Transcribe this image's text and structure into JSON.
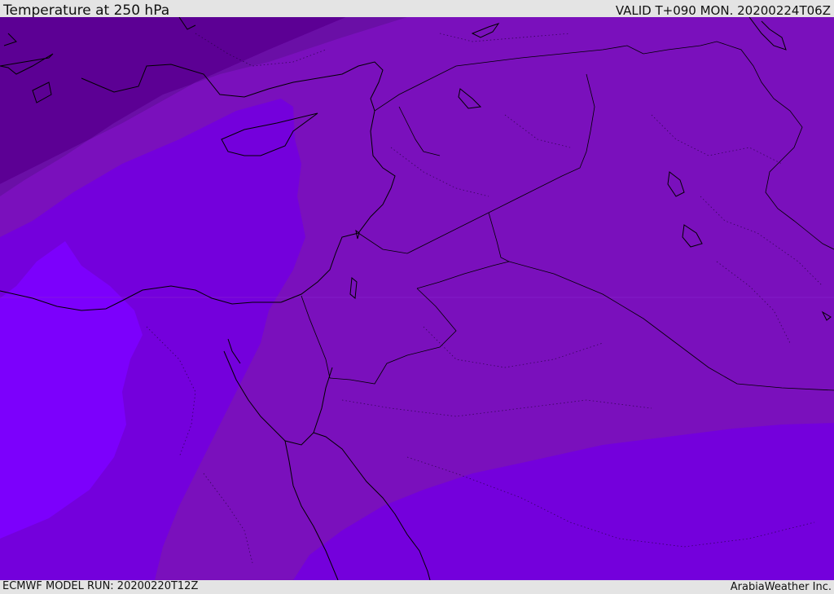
{
  "header": {
    "title": "Temperature at 250 hPa",
    "valid_time": "VALID T+090 MON. 20200224T06Z"
  },
  "footer": {
    "model_run": "ECMWF MODEL RUN: 20200220T12Z",
    "credit": "ArabiaWeather Inc."
  },
  "map": {
    "field": "temperature",
    "level": "250 hPa",
    "colors": {
      "band_darkest": "#5c0094",
      "band_dark": "#6a0fa6",
      "band_medium": "#7a10bc",
      "band_warm": "#7400dc",
      "band_warmest": "#7c00fc",
      "coastline": "#000000"
    }
  }
}
